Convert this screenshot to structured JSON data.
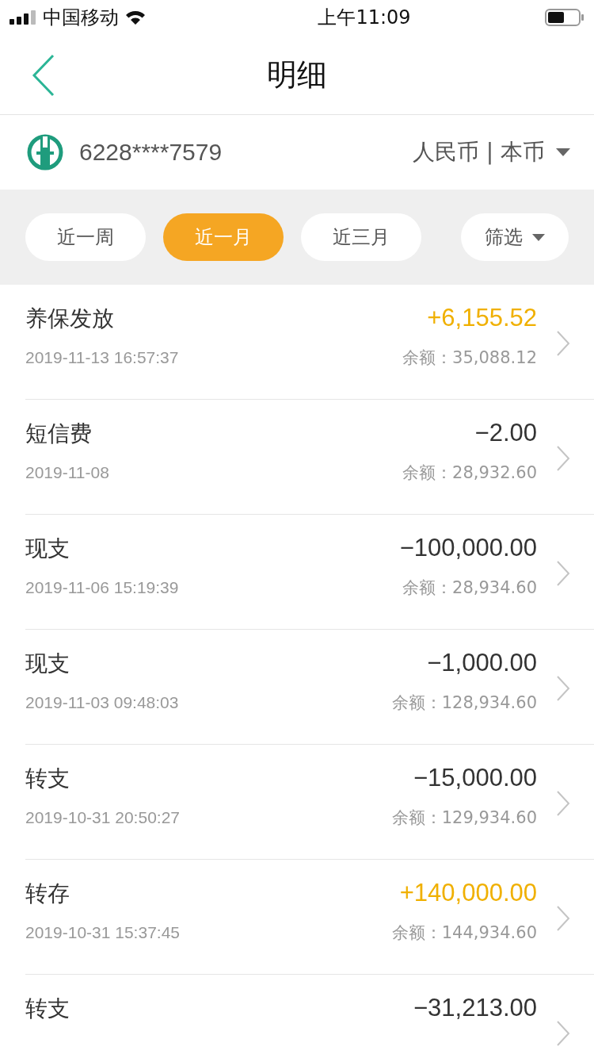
{
  "status_bar": {
    "carrier": "中国移动",
    "time": "上午11:09"
  },
  "nav": {
    "title": "明细"
  },
  "account": {
    "number": "6228****7579",
    "currency": "人民币 | 本币"
  },
  "tabs": [
    {
      "label": "近一周",
      "selected": false
    },
    {
      "label": "近一月",
      "selected": true
    },
    {
      "label": "近三月",
      "selected": false
    }
  ],
  "filter": {
    "label": "筛选"
  },
  "transactions": [
    {
      "title": "养保发放",
      "kind": "income",
      "amount": "+6,155.52",
      "date": "2019-11-13 16:57:37",
      "balance": "余额：35,088.12"
    },
    {
      "title": "短信费",
      "kind": "expense",
      "amount": "−2.00",
      "date": "2019-11-08",
      "balance": "余额：28,932.60"
    },
    {
      "title": "现支",
      "kind": "expense",
      "amount": "−100,000.00",
      "date": "2019-11-06 15:19:39",
      "balance": "余额：28,934.60"
    },
    {
      "title": "现支",
      "kind": "expense",
      "amount": "−1,000.00",
      "date": "2019-11-03 09:48:03",
      "balance": "余额：128,934.60"
    },
    {
      "title": "转支",
      "kind": "expense",
      "amount": "−15,000.00",
      "date": "2019-10-31 20:50:27",
      "balance": "余额：129,934.60"
    },
    {
      "title": "转存",
      "kind": "income",
      "amount": "+140,000.00",
      "date": "2019-10-31 15:37:45",
      "balance": "余额：144,934.60"
    },
    {
      "title": "转支",
      "kind": "expense",
      "amount": "−31,213.00"
    }
  ]
}
